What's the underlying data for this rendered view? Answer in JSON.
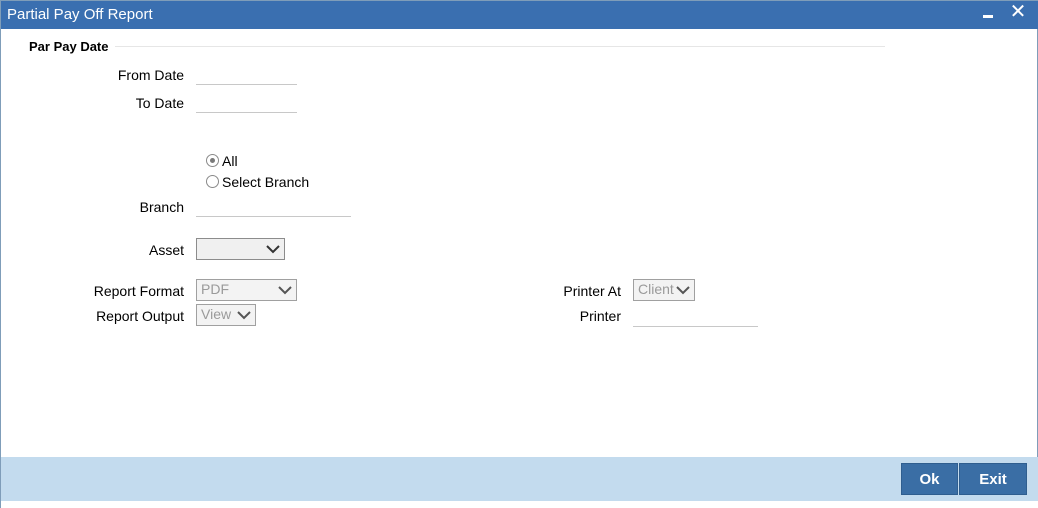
{
  "window": {
    "title": "Partial Pay Off Report",
    "minimize_label": "",
    "close_label": "✕"
  },
  "section": {
    "title": "Par Pay Date"
  },
  "from_date": {
    "label": "From Date",
    "value": ""
  },
  "to_date": {
    "label": "To Date",
    "value": ""
  },
  "branch_option": {
    "all_label": "All",
    "select_branch_label": "Select Branch",
    "selected": "All"
  },
  "branch": {
    "label": "Branch",
    "value": ""
  },
  "asset": {
    "label": "Asset",
    "value": ""
  },
  "report_format": {
    "label": "Report Format",
    "value": "PDF"
  },
  "report_output": {
    "label": "Report Output",
    "value": "View"
  },
  "printer_at": {
    "label": "Printer At",
    "value": "Client"
  },
  "printer": {
    "label": "Printer",
    "value": ""
  },
  "buttons": {
    "ok": "Ok",
    "exit": "Exit"
  },
  "colors": {
    "titlebar": "#3a6fb0",
    "footer": "#c3dbee",
    "button": "#3a6ea5"
  },
  "icons": {
    "minimize": "minimize-icon",
    "close": "close-icon",
    "dropdown": "chevron-down-icon"
  }
}
